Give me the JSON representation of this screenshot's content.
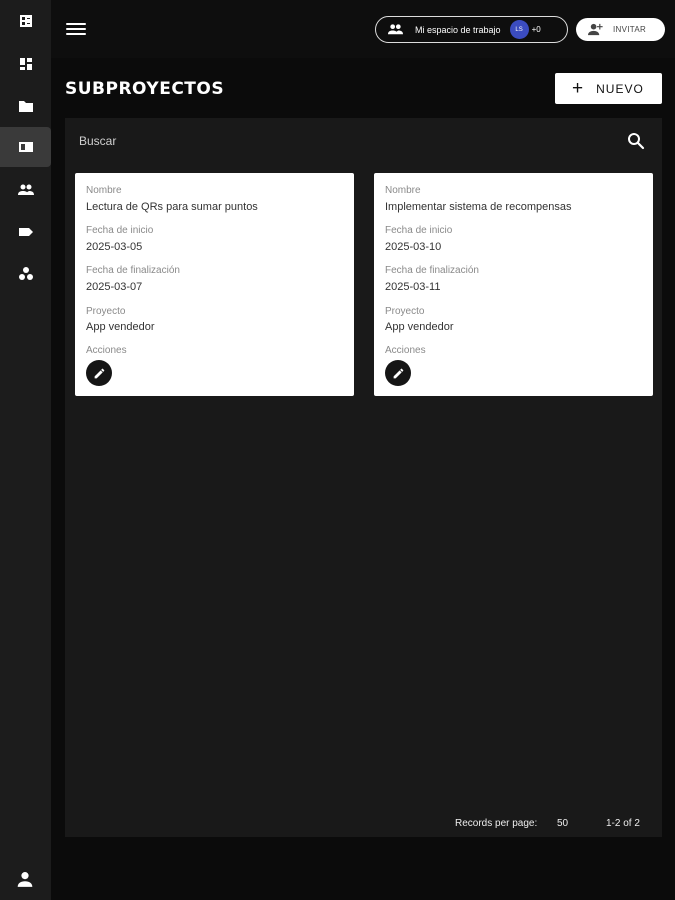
{
  "sidebar": {
    "items": [
      {
        "icon": "checklist-icon"
      },
      {
        "icon": "dashboard-icon"
      },
      {
        "icon": "folder-icon"
      },
      {
        "icon": "subprojects-icon",
        "active": true
      },
      {
        "icon": "people-icon"
      },
      {
        "icon": "label-icon"
      },
      {
        "icon": "workspaces-icon"
      }
    ],
    "footer_icon": "user-icon"
  },
  "header": {
    "workspace_label": "Mi espacio de trabajo",
    "avatar_initials": "LS",
    "member_extra": "+0",
    "invite_label": "INVITAR"
  },
  "page": {
    "title": "SUBPROYECTOS",
    "new_button_label": "NUEVO"
  },
  "search": {
    "placeholder": "Buscar"
  },
  "labels": {
    "name": "Nombre",
    "start": "Fecha de inicio",
    "end": "Fecha de finalización",
    "project": "Proyecto",
    "actions": "Acciones"
  },
  "cards": [
    {
      "name": "Lectura de QRs para sumar puntos",
      "start": "2025-03-05",
      "end": "2025-03-07",
      "project": "App vendedor"
    },
    {
      "name": "Implementar sistema de recompensas",
      "start": "2025-03-10",
      "end": "2025-03-11",
      "project": "App vendedor"
    }
  ],
  "pagination": {
    "records_per_page_label": "Records per page:",
    "records_per_page_value": "50",
    "range": "1-2 of 2"
  },
  "colors": {
    "accent_avatar": "#3b4cc0",
    "sidebar_bg": "#1c1c1c",
    "panel_bg": "#191919"
  }
}
